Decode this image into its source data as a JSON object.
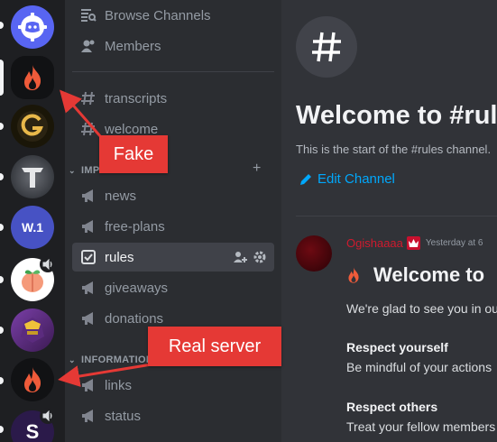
{
  "sidebar": {
    "browse_channels": "Browse Channels",
    "members": "Members",
    "channels_top": [
      {
        "label": "transcripts"
      },
      {
        "label": "welcome"
      }
    ],
    "category_important": "IMPO",
    "channels": [
      {
        "label": "news"
      },
      {
        "label": "free-plans"
      },
      {
        "label": "rules"
      },
      {
        "label": "giveaways"
      },
      {
        "label": "donations"
      }
    ],
    "category_info": "INFORMATION",
    "channels_info": [
      {
        "label": "links"
      },
      {
        "label": "status"
      }
    ]
  },
  "main": {
    "welcome_title": "Welcome to #rules",
    "welcome_sub": "This is the start of the #rules channel.",
    "edit_channel": "Edit Channel",
    "message": {
      "author": "Ogishaaaa",
      "timestamp": "Yesterday at 6",
      "title": "Welcome to",
      "lines": [
        "We're glad to see you in our server",
        "Respect yourself",
        "Be mindful of your actions",
        "Respect others",
        "Treat your fellow members"
      ]
    }
  },
  "annotations": {
    "fake_label": "Fake",
    "real_label": "Real server"
  },
  "colors": {
    "accent_link": "#00a8fc",
    "callout": "#e53935",
    "rail": "#1e1f22",
    "sidebar": "#2b2d31",
    "main": "#313338"
  }
}
